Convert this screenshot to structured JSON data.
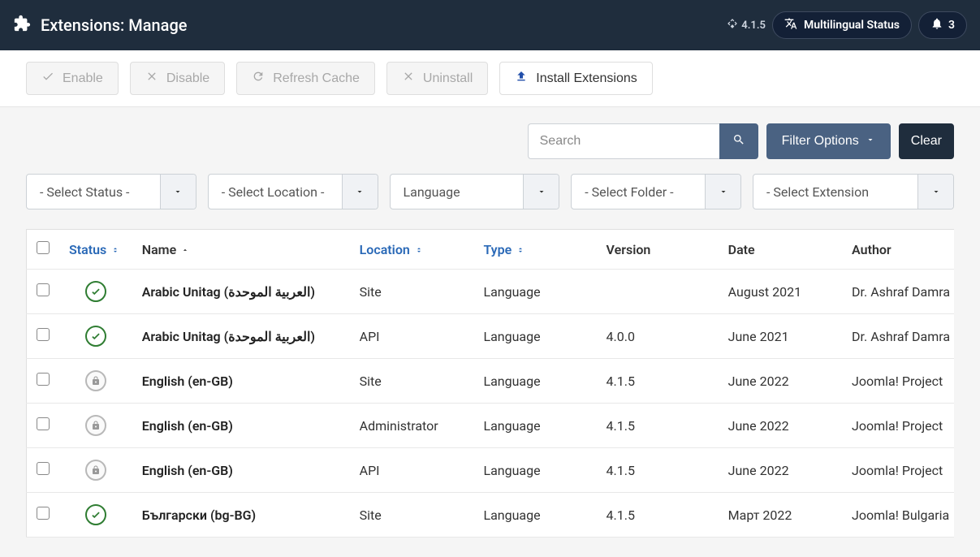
{
  "header": {
    "title": "Extensions: Manage",
    "version": "4.1.5",
    "multilingual": "Multilingual Status",
    "notif_count": "3"
  },
  "toolbar": {
    "enable": "Enable",
    "disable": "Disable",
    "refresh": "Refresh Cache",
    "uninstall": "Uninstall",
    "install": "Install Extensions"
  },
  "filters": {
    "search_placeholder": "Search",
    "filter_options": "Filter Options",
    "clear": "Clear",
    "select_status": "- Select Status -",
    "select_location": "- Select Location -",
    "select_type": "Language",
    "select_folder": "- Select Folder -",
    "select_extension": "- Select Extension"
  },
  "columns": {
    "status": "Status",
    "name": "Name",
    "location": "Location",
    "type": "Type",
    "version": "Version",
    "date": "Date",
    "author": "Author"
  },
  "rows": [
    {
      "status": "enabled",
      "name": "Arabic Unitag (العربية الموحدة)",
      "location": "Site",
      "type": "Language",
      "version": "",
      "date": "August 2021",
      "author": "Dr. Ashraf Damra"
    },
    {
      "status": "enabled",
      "name": "Arabic Unitag (العربية الموحدة)",
      "location": "API",
      "type": "Language",
      "version": "4.0.0",
      "date": "June 2021",
      "author": "Dr. Ashraf Damra"
    },
    {
      "status": "locked",
      "name": "English (en-GB)",
      "location": "Site",
      "type": "Language",
      "version": "4.1.5",
      "date": "June 2022",
      "author": "Joomla! Project"
    },
    {
      "status": "locked",
      "name": "English (en-GB)",
      "location": "Administrator",
      "type": "Language",
      "version": "4.1.5",
      "date": "June 2022",
      "author": "Joomla! Project"
    },
    {
      "status": "locked",
      "name": "English (en-GB)",
      "location": "API",
      "type": "Language",
      "version": "4.1.5",
      "date": "June 2022",
      "author": "Joomla! Project"
    },
    {
      "status": "enabled",
      "name": "Български (bg-BG)",
      "location": "Site",
      "type": "Language",
      "version": "4.1.5",
      "date": "Март 2022",
      "author": "Joomla! Bulgaria"
    }
  ]
}
